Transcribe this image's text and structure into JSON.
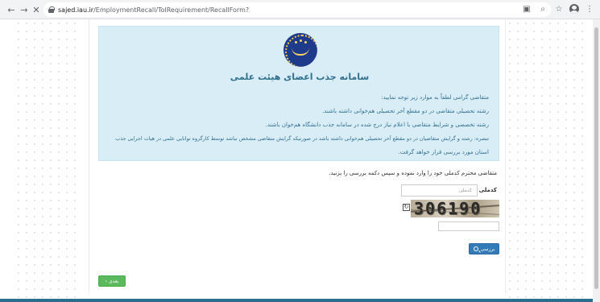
{
  "browser": {
    "url_domain": "sajed.iau.ir",
    "url_path": "/EmploymentRecall/TolRequirement/RecallForm?"
  },
  "page": {
    "system_title": "سامانه جذب اعضای هیئت علمی",
    "info_lines": [
      "متقاضی گرامی لطفاً به موارد زیر توجه نمایید:",
      "رشته تحصیلی متقاضی در دو مقطع آخر تحصیلی هم‌خوانی داشته باشند.",
      "رشته تخصصی و شرایط متقاضی با اعلام نیاز درج شده در سامانه جذب دانشگاه هم‌خوان باشند.",
      "تبصره: رشته و گرایش متقاضیان در دو مقطع آخر تحصیلی هم‌خوانی داشته باشد در صورتیکه گرایش متقاضی مشخص نباشد توسط کارگروه توانایی علمی در هیات اجرایی جذب",
      "استان مورد بررسی قرار خواهد گرفت."
    ],
    "instruction": "متقاضی محترم کدملی خود را وارد نموده و سپس دکمه بررسی را بزنید.",
    "code_label": "کدملی",
    "code_placeholder": "کدملی",
    "captcha_text": "306190",
    "refresh_glyph": "↻",
    "check_button": "بررسی",
    "next_button": "بعدی ›"
  },
  "colors": {
    "info_bg": "#d9edf7",
    "info_text": "#31708f",
    "primary": "#337ab7",
    "success": "#5cb85c"
  }
}
